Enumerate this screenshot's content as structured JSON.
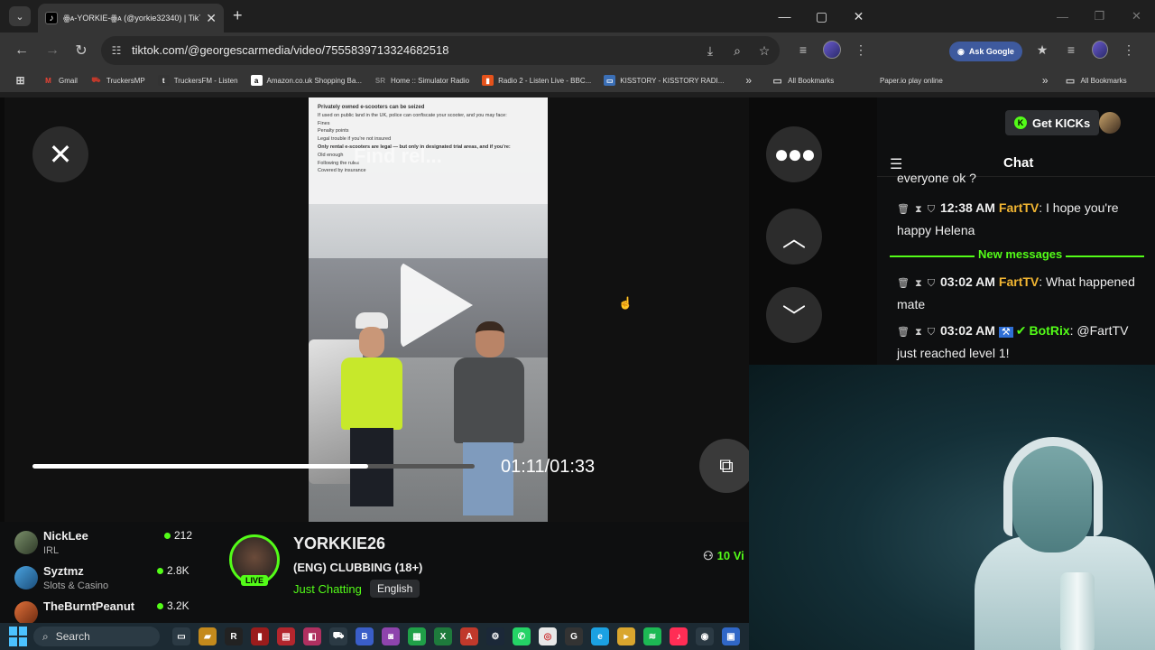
{
  "browser_left": {
    "tab_title": "ꙮᴀ-YORKIE-ꙮᴀ (@yorkie32340) | TikTok",
    "url": "tiktok.com/@georgescarmedia/video/7555839713324682518",
    "bookmarks": [
      {
        "label": "Gmail",
        "icon": "gmail-icon",
        "color": "#ea4335"
      },
      {
        "label": "TruckersMP",
        "icon": "truck-icon",
        "color": "#c0392b"
      },
      {
        "label": "TruckersFM - Listen",
        "icon": "t-icon",
        "color": "#333333"
      },
      {
        "label": "Amazon.co.uk Shopping Ba...",
        "icon": "amazon-icon",
        "color": "#ffffff"
      },
      {
        "label": "Home :: Simulator Radio",
        "icon": "sr-icon",
        "color": "#666666"
      },
      {
        "label": "Radio 2 - Listen Live - BBC...",
        "icon": "radio-icon",
        "color": "#e5521b"
      },
      {
        "label": "KISSTORY - KISSTORY RADI...",
        "icon": "kiss-icon",
        "color": "#3b6fb6"
      }
    ],
    "all_bookmarks": "All Bookmarks"
  },
  "browser_right": {
    "ask_google": "Ask Google",
    "bookmark": "Paper.io play online",
    "all_bookmarks": "All Bookmarks"
  },
  "video": {
    "notice_heading": "Privately owned e-scooters can be seized",
    "notice_lines": [
      "If used on public land in the UK, police can confiscate your scooter, and you may face:",
      "Fines",
      "Penalty points",
      "Legal trouble if you're not insured",
      "Only rental e-scooters are legal — but only in designated trial areas, and if you're:",
      "Old enough",
      "Following the rules",
      "Covered by insurance"
    ],
    "search_ghost": "Find rel...",
    "time": "01:11/01:33",
    "progress": 0.76
  },
  "chat": {
    "get_kicks": "Get KICKs",
    "title": "Chat",
    "partial_top": "everyone ok ?",
    "new_messages": "New messages",
    "messages": [
      {
        "time": "12:38 AM",
        "user": "FartTV",
        "text": ": I hope you're happy Helena"
      },
      {
        "time": "03:02 AM",
        "user": "FartTV",
        "text": ": What happened mate"
      },
      {
        "time": "03:02 AM",
        "user": "BotRix",
        "text": ": @FartTV just reached level 1!"
      }
    ]
  },
  "channels": [
    {
      "name": "NickLee",
      "category": "IRL",
      "viewers": "212"
    },
    {
      "name": "Syztmz",
      "category": "Slots & Casino",
      "viewers": "2.8K"
    },
    {
      "name": "TheBurntPeanut",
      "category": "",
      "viewers": "3.2K"
    }
  ],
  "stream": {
    "name": "YORKKIE26",
    "title": "(ENG) CLUBBING (18+)",
    "category": "Just Chatting",
    "language": "English",
    "live": "LIVE",
    "viewers": "10 Vi"
  },
  "taskbar": {
    "search": "Search"
  },
  "colors": {
    "kick_green": "#53fc18",
    "chat_user": "#f1b532"
  }
}
